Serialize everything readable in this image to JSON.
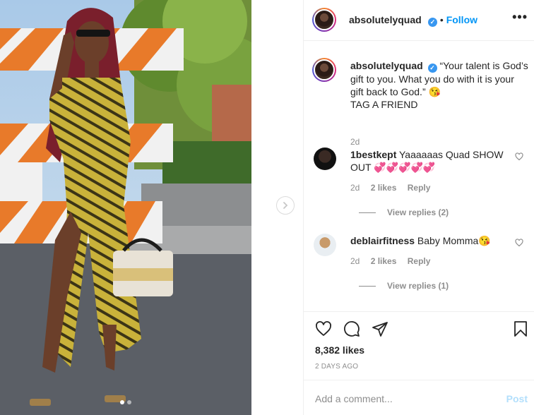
{
  "post": {
    "username": "absolutelyquad",
    "follow_label": "Follow",
    "separator": "•",
    "more_label": "•••",
    "verified_mark": "✓"
  },
  "caption": {
    "username": "absolutelyquad",
    "text": "“Your talent is God’s gift to you. What you do with it is your gift back to God.” 😘",
    "tag": "TAG A FRIEND",
    "age": "2d"
  },
  "comments": [
    {
      "username": "1bestkept",
      "text": "Yaaaaaas Quad SHOW OUT 💞💞💞💞💞",
      "age": "2d",
      "likes": "2 likes",
      "reply_label": "Reply",
      "view_replies": "View replies (2)"
    },
    {
      "username": "deblairfitness",
      "text": "Baby Momma😘",
      "age": "2d",
      "likes": "2 likes",
      "reply_label": "Reply",
      "view_replies": "View replies (1)"
    }
  ],
  "engagement": {
    "likes": "8,382 likes",
    "date": "2 DAYS AGO"
  },
  "composer": {
    "placeholder": "Add a comment...",
    "post_label": "Post"
  },
  "carousel": {
    "current": 1,
    "total": 2
  },
  "icons": {
    "like": "heart-icon",
    "comment": "comment-icon",
    "share": "paper-plane-icon",
    "save": "bookmark-icon",
    "next": "chevron-right-icon"
  },
  "colors": {
    "link_blue": "#0095f6",
    "verified_blue": "#3897f0",
    "muted": "#8e8e8e",
    "post_disabled": "#b2dffc"
  }
}
